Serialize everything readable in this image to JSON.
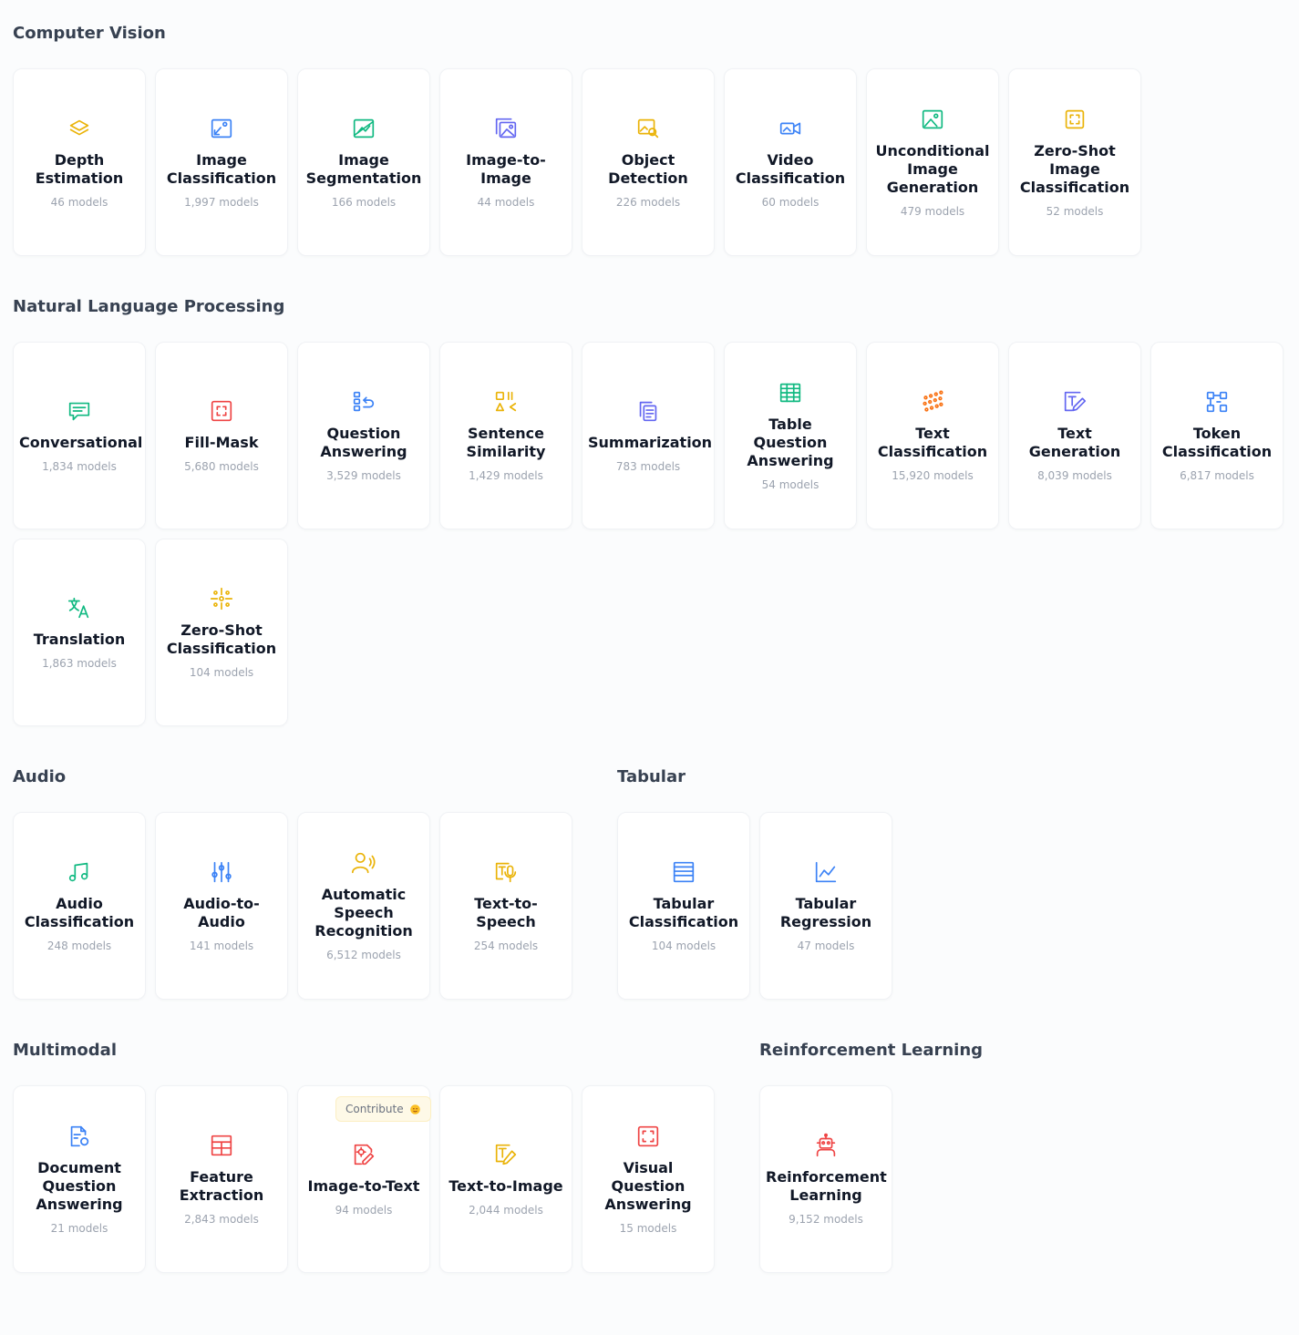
{
  "sections": [
    {
      "title": "Computer Vision",
      "tasks": [
        {
          "title": "Depth Estimation",
          "count": "46 models",
          "icon": "layers-icon",
          "color": "#eab308"
        },
        {
          "title": "Image Classification",
          "count": "1,997 models",
          "icon": "image-classification-icon",
          "color": "#3b82f6"
        },
        {
          "title": "Image Segmentation",
          "count": "166 models",
          "icon": "image-segmentation-icon",
          "color": "#10b981"
        },
        {
          "title": "Image-to-Image",
          "count": "44 models",
          "icon": "image-to-image-icon",
          "color": "#6366f1"
        },
        {
          "title": "Object Detection",
          "count": "226 models",
          "icon": "object-detection-icon",
          "color": "#eab308"
        },
        {
          "title": "Video Classification",
          "count": "60 models",
          "icon": "video-icon",
          "color": "#3b82f6"
        },
        {
          "title": "Unconditional Image Generation",
          "count": "479 models",
          "icon": "image-generation-icon",
          "color": "#10b981"
        },
        {
          "title": "Zero-Shot Image Classification",
          "count": "52 models",
          "icon": "zero-shot-image-icon",
          "color": "#eab308"
        }
      ]
    },
    {
      "title": "Natural Language Processing",
      "tasks": [
        {
          "title": "Conversational",
          "count": "1,834 models",
          "icon": "chat-icon",
          "color": "#10b981"
        },
        {
          "title": "Fill-Mask",
          "count": "5,680 models",
          "icon": "fill-mask-icon",
          "color": "#ef4444"
        },
        {
          "title": "Question Answering",
          "count": "3,529 models",
          "icon": "question-answering-icon",
          "color": "#3b82f6"
        },
        {
          "title": "Sentence Similarity",
          "count": "1,429 models",
          "icon": "sentence-similarity-icon",
          "color": "#eab308"
        },
        {
          "title": "Summarization",
          "count": "783 models",
          "icon": "summarization-icon",
          "color": "#6366f1"
        },
        {
          "title": "Table Question Answering",
          "count": "54 models",
          "icon": "table-icon",
          "color": "#10b981"
        },
        {
          "title": "Text Classification",
          "count": "15,920 models",
          "icon": "text-classification-icon",
          "color": "#f97316"
        },
        {
          "title": "Text Generation",
          "count": "8,039 models",
          "icon": "text-generation-icon",
          "color": "#6366f1"
        },
        {
          "title": "Token Classification",
          "count": "6,817 models",
          "icon": "token-classification-icon",
          "color": "#3b82f6"
        },
        {
          "title": "Translation",
          "count": "1,863 models",
          "icon": "translation-icon",
          "color": "#10b981"
        },
        {
          "title": "Zero-Shot Classification",
          "count": "104 models",
          "icon": "zero-shot-classification-icon",
          "color": "#eab308"
        }
      ]
    },
    {
      "title": "Audio",
      "tasks": [
        {
          "title": "Audio Classification",
          "count": "248 models",
          "icon": "music-note-icon",
          "color": "#10b981"
        },
        {
          "title": "Audio-to-Audio",
          "count": "141 models",
          "icon": "equalizer-icon",
          "color": "#3b82f6"
        },
        {
          "title": "Automatic Speech Recognition",
          "count": "6,512 models",
          "icon": "speech-recognition-icon",
          "color": "#eab308"
        },
        {
          "title": "Text-to-Speech",
          "count": "254 models",
          "icon": "text-to-speech-icon",
          "color": "#eab308"
        }
      ]
    },
    {
      "title": "Tabular",
      "tasks": [
        {
          "title": "Tabular Classification",
          "count": "104 models",
          "icon": "tabular-classification-icon",
          "color": "#3b82f6"
        },
        {
          "title": "Tabular Regression",
          "count": "47 models",
          "icon": "line-chart-icon",
          "color": "#3b82f6"
        }
      ]
    },
    {
      "title": "Multimodal",
      "tasks": [
        {
          "title": "Document Question Answering",
          "count": "21 models",
          "icon": "document-search-icon",
          "color": "#3b82f6"
        },
        {
          "title": "Feature Extraction",
          "count": "2,843 models",
          "icon": "feature-extraction-icon",
          "color": "#ef4444"
        },
        {
          "title": "Image-to-Text",
          "count": "94 models",
          "icon": "image-to-text-icon",
          "color": "#ef4444",
          "badge": "Contribute"
        },
        {
          "title": "Text-to-Image",
          "count": "2,044 models",
          "icon": "text-to-image-icon",
          "color": "#eab308"
        },
        {
          "title": "Visual Question Answering",
          "count": "15 models",
          "icon": "visual-question-answering-icon",
          "color": "#ef4444"
        }
      ]
    },
    {
      "title": "Reinforcement Learning",
      "tasks": [
        {
          "title": "Reinforcement Learning",
          "count": "9,152 models",
          "icon": "robot-icon",
          "color": "#ef4444"
        }
      ]
    }
  ]
}
